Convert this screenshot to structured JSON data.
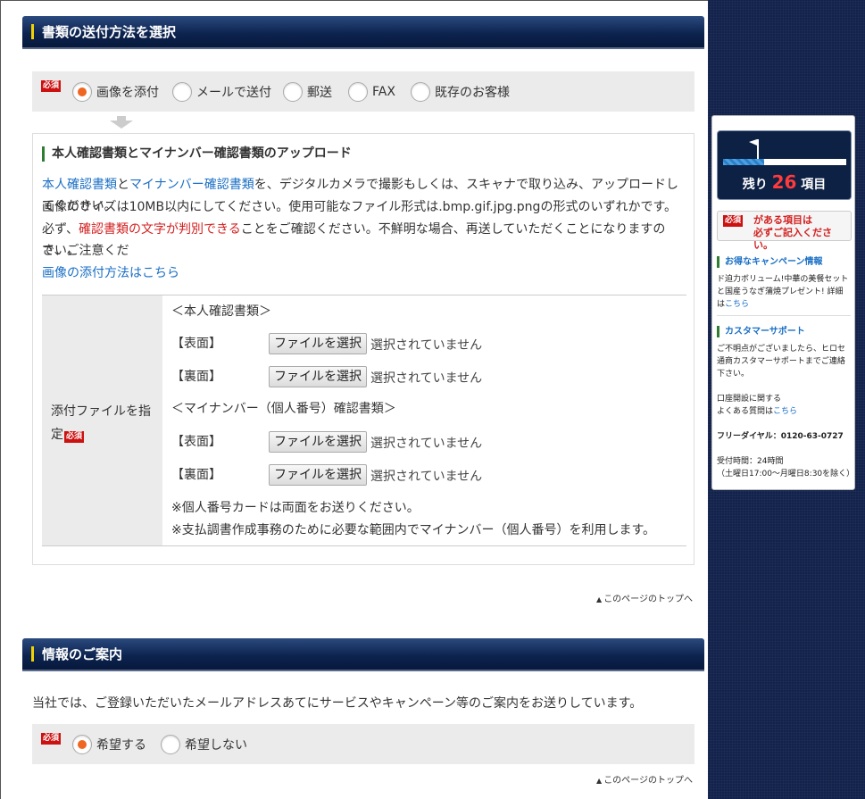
{
  "section1": {
    "title": "書類の送付方法を選択",
    "required_badge": "必須",
    "methods": [
      "画像を添付",
      "メールで送付",
      "郵送",
      "FAX",
      "既存のお客様"
    ],
    "selected_method": "画像を添付"
  },
  "upload": {
    "title": "本人確認書類とマイナンバー確認書類のアップロード",
    "desc1_link1": "本人確認書類",
    "desc1_and": "と",
    "desc1_link2": "マイナンバー確認書類",
    "desc1_rest": "を、デジタルカメラで撮影もしくは、スキャナで取り込み、アップロードしてください。",
    "desc2": "画像のサイズは10MB以内にしてください。使用可能なファイル形式は.bmp.gif.jpg.pngの形式のいずれかです。",
    "desc3_pre": "必ず、",
    "desc3_red": "確認書類の文字が判別できる",
    "desc3_rest": "ことをご確認ください。不鮮明な場合、再送していただくことになりますので、ご注意くだ",
    "desc3_cont": "さい。",
    "how_to_link": "画像の添付方法はこちら",
    "field_label": "添付ファイルを指定",
    "group1": "＜本人確認書類＞",
    "group2": "＜マイナンバー（個人番号）確認書類＞",
    "front": "【表面】",
    "back": "【裏面】",
    "choose_file": "ファイルを選択",
    "no_file": "選択されていません",
    "note1": "※個人番号カードは両面をお送りください。",
    "note2": "※支払調書作成事務のために必要な範囲内でマイナンバー（個人番号）を利用します。"
  },
  "page_top": "このページのトップへ",
  "section2": {
    "title": "情報のご案内",
    "text": "当社では、ご登録いただいたメールアドレスあてにサービスやキャンペーン等のご案内をお送りしています。",
    "options": [
      "希望する",
      "希望しない"
    ],
    "selected": "希望する"
  },
  "sidebar": {
    "remaining_prefix": "残り",
    "remaining_count": "26",
    "remaining_suffix": "項目",
    "progress_fraction": 0.33,
    "warn_line1": "がある項目は",
    "warn_line2": "必ずご記入ください。",
    "campaign_title": "お得なキャンペーン情報",
    "campaign_text": "ド迫力ボリューム!中華の美餐セットと国産うなぎ蒲焼プレゼント! 詳細は",
    "campaign_link": "こちら",
    "support_title": "カスタマーサポート",
    "support_text": "ご不明点がございましたら、ヒロセ通商カスタマーサポートまでご連絡下さい。",
    "faq_line1": "口座開設に関する",
    "faq_line2": "よくある質問は",
    "faq_link": "こちら",
    "free_dial": "フリーダイヤル：0120-63-0727",
    "hours1": "受付時間：24時間",
    "hours2": "（土曜日17:00～月曜日8:30を除く）"
  },
  "colors": {
    "header_navy": "#0d2450",
    "accent_yellow": "#f2d100",
    "required_red": "#cc1111",
    "radio_orange": "#ee6622",
    "link_blue": "#1a6fc4"
  }
}
